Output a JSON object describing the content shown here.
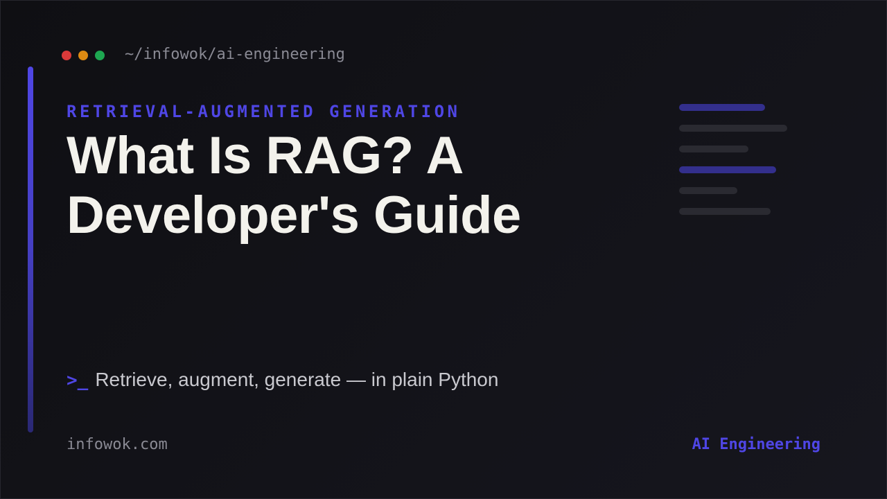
{
  "window": {
    "path": "~/infowok/ai-engineering",
    "dots": [
      {
        "name": "close",
        "color": "#dc3a3a"
      },
      {
        "name": "minimize",
        "color": "#dd8a12"
      },
      {
        "name": "maximize",
        "color": "#1ea751"
      }
    ]
  },
  "colors": {
    "accent": "#4f46e5",
    "accent_muted": "#332f8c",
    "line_muted": "#2a2a31",
    "title": "#f3f2ec",
    "subtle_text": "#8a8a94"
  },
  "header": {
    "eyebrow": "RETRIEVAL-AUGMENTED GENERATION",
    "title": "What Is RAG? A Developer's Guide"
  },
  "tagline": {
    "prompt": ">_",
    "text": "Retrieve, augment, generate — in plain Python"
  },
  "footer": {
    "domain": "infowok.com",
    "category": "AI Engineering"
  }
}
